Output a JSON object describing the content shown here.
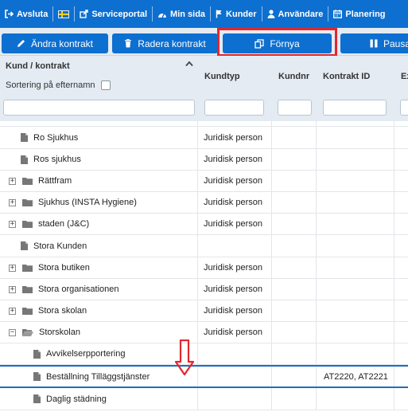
{
  "nav": {
    "items": [
      {
        "label": "Avsluta",
        "icon": "logout-icon"
      },
      {
        "label": "",
        "icon": "swedish-flag-icon"
      },
      {
        "label": "Serviceportal",
        "icon": "external-link-icon"
      },
      {
        "label": "Min sida",
        "icon": "dashboard-icon"
      },
      {
        "label": "Kunder",
        "icon": "flag-icon"
      },
      {
        "label": "Användare",
        "icon": "user-icon"
      },
      {
        "label": "Planering",
        "icon": "calendar-icon"
      }
    ]
  },
  "actions": {
    "edit_label": "Ändra kontrakt",
    "delete_label": "Radera kontrakt",
    "renew_label": "Förnya",
    "pause_label": "Pausa"
  },
  "header": {
    "col_customer": "Kund / kontrakt",
    "sort_label": "Sortering på efternamn",
    "col_type": "Kundtyp",
    "col_number": "Kundnr",
    "col_contract_id": "Kontrakt ID",
    "col_extra": "Ex"
  },
  "rows": [
    {
      "label": "Ro Sjukhus",
      "type": "Juridisk person",
      "contract_id": ""
    },
    {
      "label": "Ros sjukhus",
      "type": "Juridisk person",
      "contract_id": ""
    },
    {
      "label": "Rättfram",
      "type": "Juridisk person",
      "contract_id": ""
    },
    {
      "label": "Sjukhus (INSTA Hygiene)",
      "type": "Juridisk person",
      "contract_id": ""
    },
    {
      "label": "staden (J&C)",
      "type": "Juridisk person",
      "contract_id": ""
    },
    {
      "label": "Stora Kunden",
      "type": "",
      "contract_id": ""
    },
    {
      "label": "Stora butiken",
      "type": "Juridisk person",
      "contract_id": ""
    },
    {
      "label": "Stora organisationen",
      "type": "Juridisk person",
      "contract_id": ""
    },
    {
      "label": "Stora skolan",
      "type": "Juridisk person",
      "contract_id": ""
    },
    {
      "label": "Storskolan",
      "type": "Juridisk person",
      "contract_id": ""
    },
    {
      "label": "Avvikelserpportering",
      "type": "",
      "contract_id": ""
    },
    {
      "label": "Beställning Tilläggstjänster",
      "type": "",
      "contract_id": "AT2220, AT2221"
    },
    {
      "label": "Daglig städning",
      "type": "",
      "contract_id": ""
    }
  ],
  "colors": {
    "primary": "#0d6fd0",
    "header_bg": "#e4ebf2",
    "highlight": "#e3262c",
    "selected_border": "#1d6fc2"
  }
}
